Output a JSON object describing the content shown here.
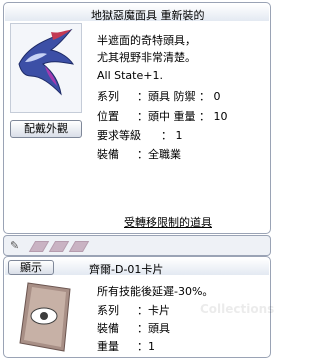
{
  "item_window": {
    "title": "地獄惡魔面具 重新裝的",
    "description_line1": "半遮面的奇特頭具，",
    "description_line2": "尤其視野非常清楚。",
    "stat_line": "All State+1.",
    "rows": [
      {
        "label": "系列",
        "value": "：頭具 防禦 ： 0"
      },
      {
        "label": "位置",
        "value": "：頭中 重量 ： 10"
      },
      {
        "label": "要求等級",
        "value": "： 1"
      },
      {
        "label": "裝備",
        "value": "：全職業"
      }
    ],
    "restriction_link": "受轉移限制的道具",
    "appearance_button": "配戴外觀"
  },
  "card_window": {
    "title": "齊爾-D-01卡片",
    "show_button": "顯示",
    "effect": "所有技能後延遲-30%。",
    "rows": [
      {
        "label": "系列",
        "value": "：卡片"
      },
      {
        "label": "裝備",
        "value": "：頭具"
      },
      {
        "label": "重量",
        "value": "：1"
      }
    ]
  },
  "watermark": "Collections",
  "colors": {
    "window_border": "#9aa3b5",
    "title_gradient_bottom": "#e3e9f2",
    "slot": "#c9b3c3"
  }
}
